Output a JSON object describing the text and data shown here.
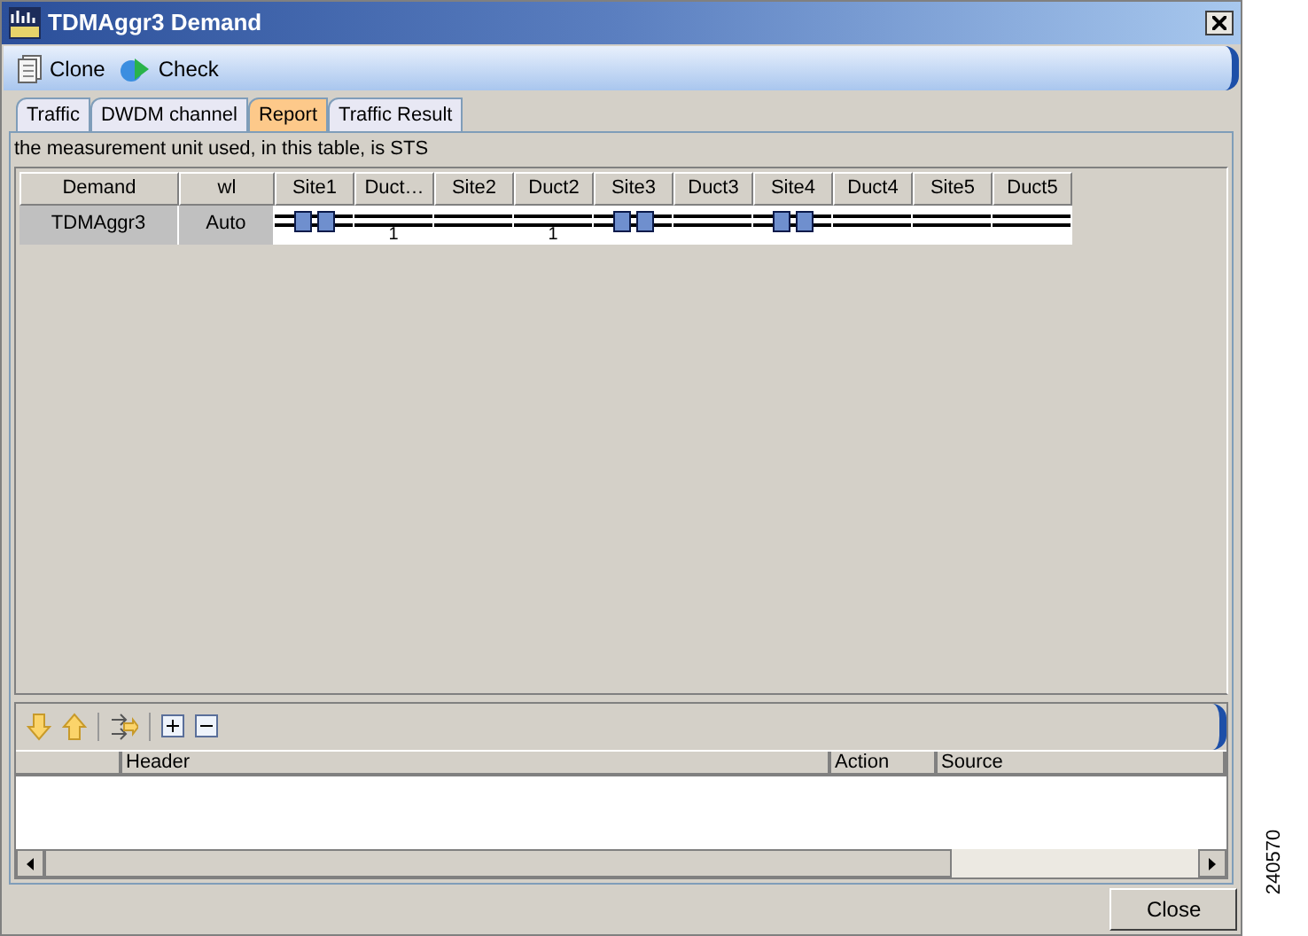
{
  "window": {
    "title": "TDMAggr3 Demand"
  },
  "toolbar": [
    {
      "label": "Clone",
      "kind": "clone"
    },
    {
      "label": "Check",
      "kind": "check"
    }
  ],
  "tabs": [
    {
      "label": "Traffic",
      "selected": false
    },
    {
      "label": "DWDM channel",
      "selected": false
    },
    {
      "label": "Report",
      "selected": true
    },
    {
      "label": "Traffic Result",
      "selected": false
    }
  ],
  "unit_note": "the measurement unit used, in this table, is  STS",
  "grid": {
    "columns": [
      "Demand",
      "wl",
      "Site1",
      "Duct…",
      "Site2",
      "Duct2",
      "Site3",
      "Duct3",
      "Site4",
      "Duct4",
      "Site5",
      "Duct5"
    ],
    "rows": [
      {
        "cells": [
          {
            "kind": "text",
            "text": "TDMAggr3"
          },
          {
            "kind": "text",
            "text": "Auto"
          },
          {
            "kind": "node"
          },
          {
            "kind": "line",
            "label": "1"
          },
          {
            "kind": "line"
          },
          {
            "kind": "line",
            "label": "1"
          },
          {
            "kind": "node"
          },
          {
            "kind": "line"
          },
          {
            "kind": "node"
          },
          {
            "kind": "line"
          },
          {
            "kind": "line"
          },
          {
            "kind": "line"
          }
        ]
      }
    ]
  },
  "log_table": {
    "columns": [
      "Header",
      "Action",
      "Source"
    ]
  },
  "buttons": [
    "Close"
  ],
  "figure_number": "240570"
}
